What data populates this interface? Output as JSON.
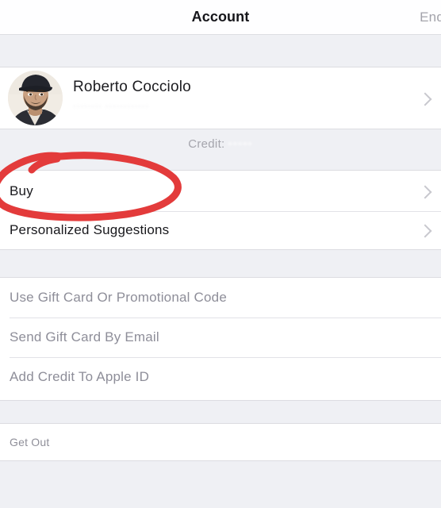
{
  "navbar": {
    "title": "Account",
    "right_action": "End"
  },
  "profile": {
    "name": "Roberto Cocciolo",
    "email_redacted": "•••••••• ••••••••••••",
    "chevron_icon": "chevron-right-icon",
    "avatar_icon": "user-photo-avatar"
  },
  "credit": {
    "label": "Credit:",
    "value_redacted": "•••••"
  },
  "purchase_rows": [
    {
      "label": "Buy",
      "chevron_icon": "chevron-right-icon"
    },
    {
      "label": "Personalized Suggestions",
      "chevron_icon": "chevron-right-icon"
    }
  ],
  "giftcard_rows": [
    {
      "label": "Use Gift Card Or Promotional Code"
    },
    {
      "label": "Send Gift Card By Email"
    },
    {
      "label": "Add Credit To Apple ID"
    }
  ],
  "signout": {
    "label": "Get Out"
  },
  "annotation": {
    "type": "hand-drawn-ellipse",
    "color": "#e33b3b",
    "targets": "Buy"
  },
  "colors": {
    "background": "#eff0f4",
    "card": "#ffffff",
    "separator": "#e2e2e7",
    "title_text": "#15151a",
    "muted_text": "#8e8e99",
    "chevron": "#c8c8ce",
    "annotation_red": "#e33b3b"
  }
}
